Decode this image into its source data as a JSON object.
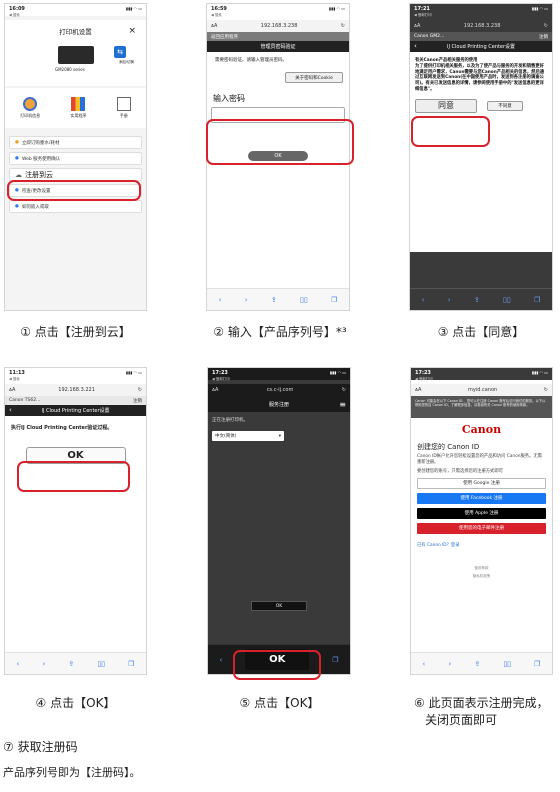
{
  "phones": {
    "p1": {
      "time": "16:09",
      "back": "◀ 搜索",
      "title": "打印机设置",
      "close": "×",
      "model": "GM2080 series",
      "add_label": "添加/切换",
      "icons": [
        "打印机信息",
        "实用程序",
        "手册"
      ],
      "menu": [
        "立即订购墨水/耗材",
        "Web 服务使用确认",
        "注册到云",
        "检查/更改设置",
        "如何嵌入或取"
      ]
    },
    "p2": {
      "time": "16:59",
      "back": "◀ 搜索",
      "url": "192.168.3.238",
      "nav": "返回应用程序",
      "header": "管理员密码验证",
      "message": "需要密码验证。请输入管理员密码。",
      "cookie_btn": "关于密码和Cookie",
      "label": "输入密码",
      "ok": "OK"
    },
    "p3": {
      "time": "17:21",
      "back": "◀ 借邮打印",
      "url": "192.168.3.238",
      "gray": "Canon GM2...",
      "gray_right": "注销",
      "header": "IJ Cloud Printing Center设置",
      "body": "有关Canon产品相关服务的使用\n为了提供打印机相关服务，以及为了使产品与服务的开发和销售更好地满足用户需求，Canon需要与您Canon产品相关的信息，然后通过互联网发送到Canon(在中国使用产品时，发送到各注册的调查公司)。有关已发送信息的详情，请参阅使用手册中的\"发送信息的更详细信息\"。",
      "agree": "同意",
      "disagree": "不同意"
    },
    "p4": {
      "time": "11:13",
      "back": "◀ 搜索",
      "url": "192.168.3.221",
      "gray": "Canon TS62...",
      "gray_right": "注销",
      "header": "IJ Cloud Printing Center设置",
      "message": "执行IJ Cloud Printing Center验证过程。",
      "ok": "OK"
    },
    "p5": {
      "time": "17:23",
      "back": "◀ 借邮打印",
      "url": "cs.c-ij.com",
      "header": "服务注册",
      "message": "正在注册打印机。",
      "select": "中文(简体)",
      "ok_small": "OK",
      "ok_big": "OK"
    },
    "p6": {
      "time": "17:23",
      "back": "◀ 借邮打印",
      "url": "myid.canon",
      "notice": "Canon 可能会在以下 Canon ID 、您可以在注册 Canon 账号后访问我们的服务。以下以帮助您的自 Canon ID，了解更多信息，请参阅有关 Canon 账号的使用条款。",
      "logo": "Canon",
      "heading": "创建您的 Canon ID",
      "desc": "Canon ID帐户允许您轻松设置您的产品和访问 Canon服务。无需重新注册。",
      "desc2": "要创建您的账号，只需选择您的注册方式即可",
      "google": "使用 Google 注册",
      "facebook": "使用 Facebook 注册",
      "apple": "使用 Apple 注册",
      "email": "使用您的电子邮件注册",
      "link": "已有 Canon ID？登录",
      "footer1": "使用条款",
      "footer2": "隐私权政策"
    }
  },
  "captions": {
    "c1": "① 点击【注册到云】",
    "c2": "② 输入【产品序列号】*³",
    "c3": "③ 点击【同意】",
    "c4": "④ 点击【OK】",
    "c5": "⑤ 点击【OK】",
    "c6a": "⑥ 此页面表示注册完成，",
    "c6b": "关闭页面即可"
  },
  "step7": {
    "title": "⑦ 获取注册码",
    "note": "产品序列号即为【注册码】。"
  },
  "colors": {
    "accent_red": "#d8222b",
    "canon_red": "#cc0000",
    "facebook": "#1877f2",
    "ios_blue": "#3478f6"
  }
}
